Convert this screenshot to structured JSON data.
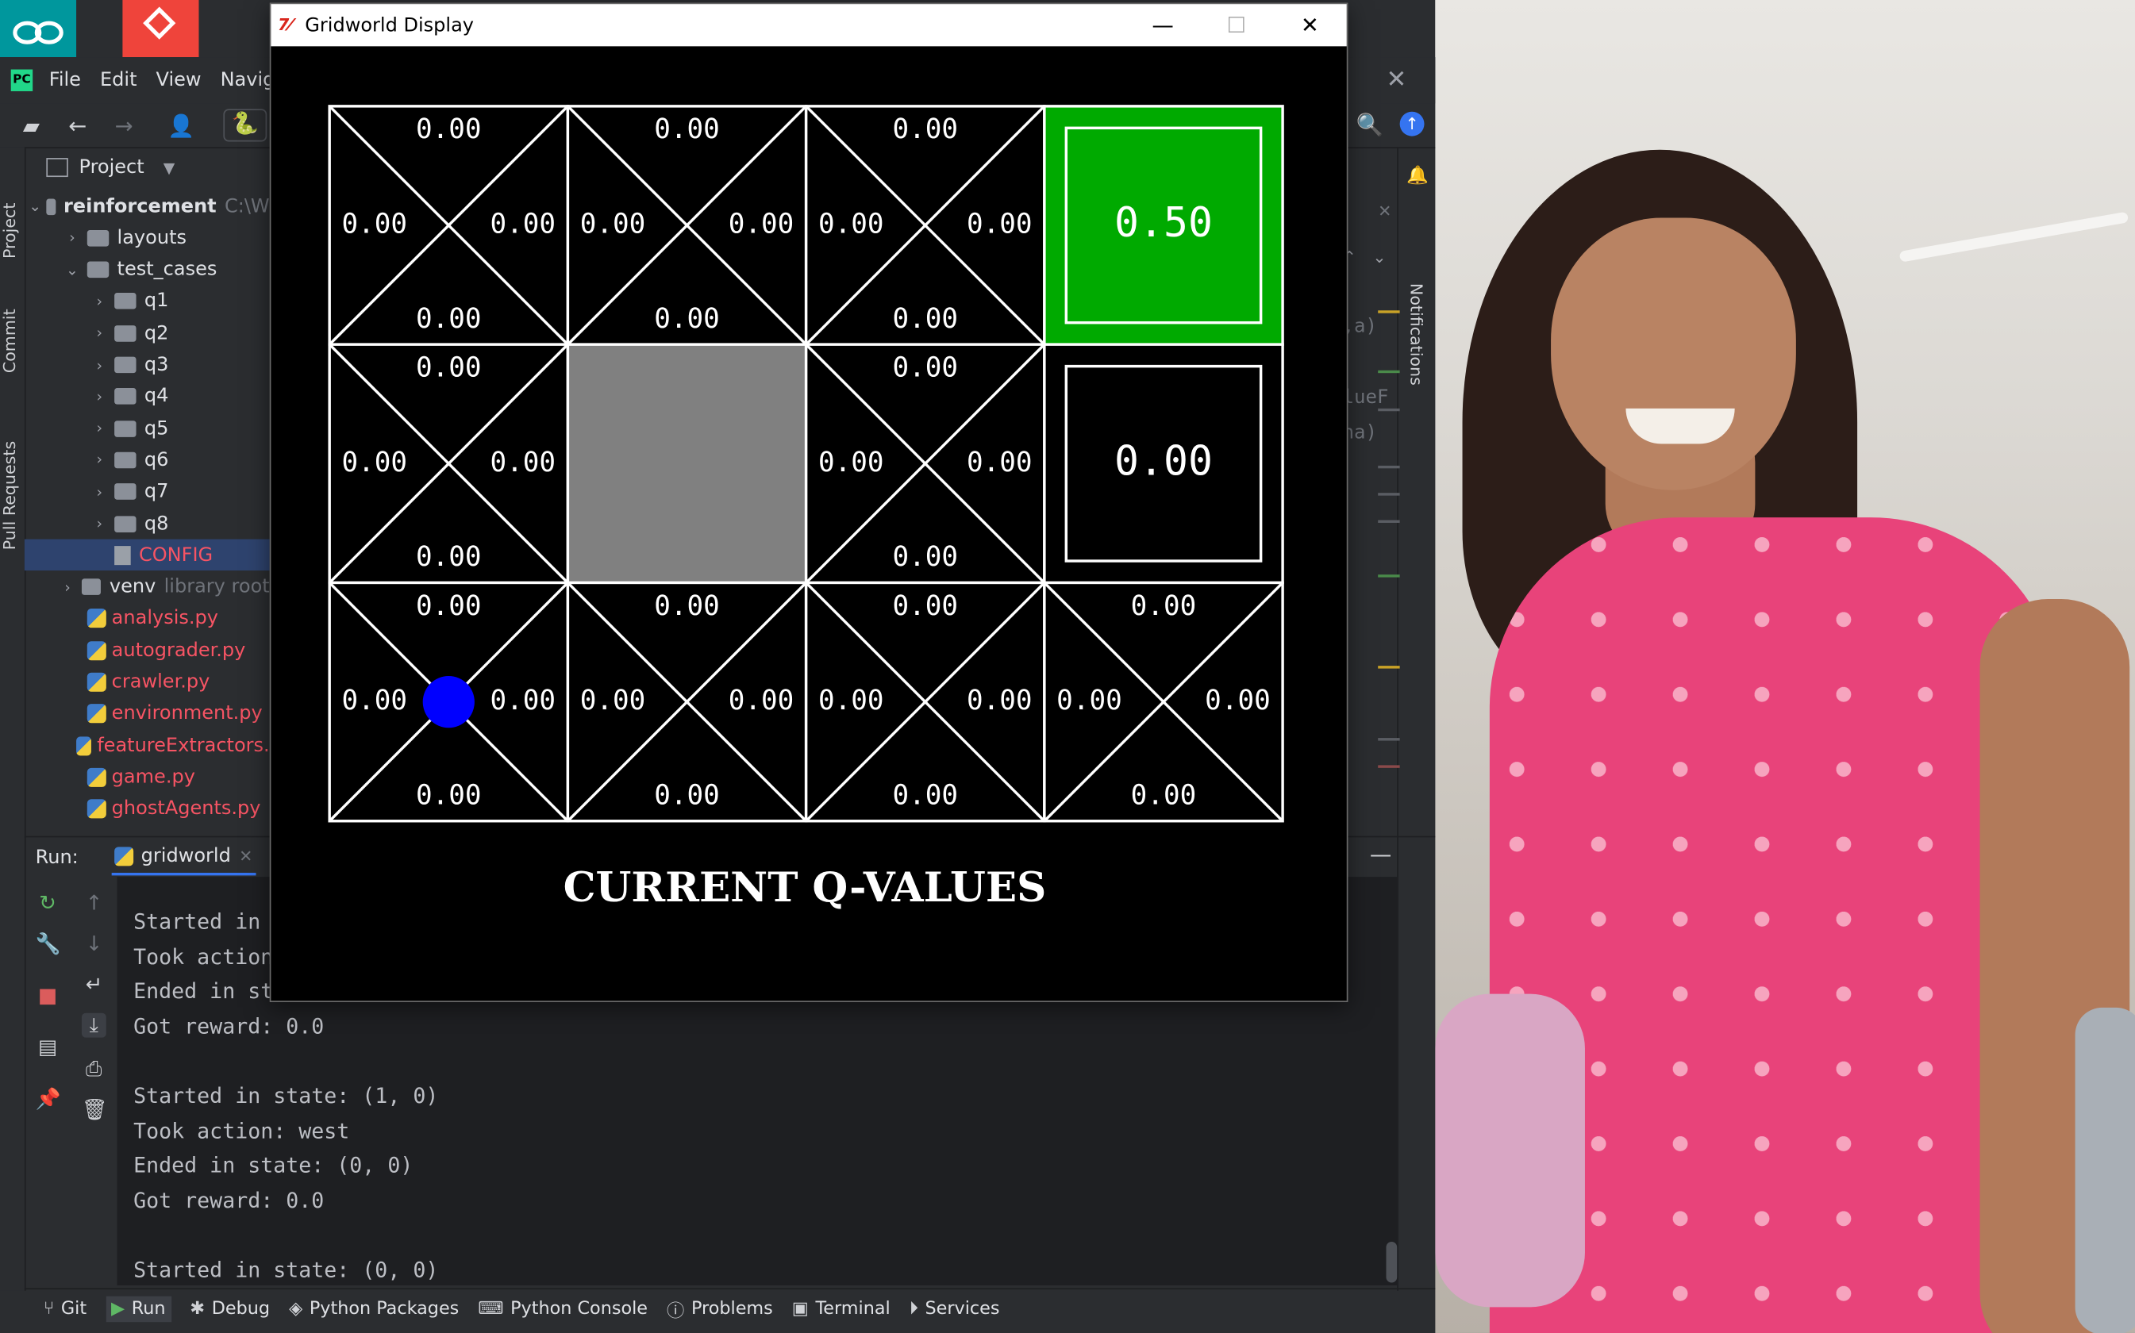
{
  "ide": {
    "menu": [
      "File",
      "Edit",
      "View",
      "Navig"
    ],
    "project_label": "Project",
    "tree": [
      {
        "label": "reinforcement",
        "suffix": "C:\\W",
        "kind": "folder",
        "expanded": true,
        "depth": 0
      },
      {
        "label": "layouts",
        "kind": "folder",
        "expanded": false,
        "depth": 1
      },
      {
        "label": "test_cases",
        "kind": "folder",
        "expanded": true,
        "depth": 1
      },
      {
        "label": "q1",
        "kind": "folder",
        "expanded": false,
        "depth": 2
      },
      {
        "label": "q2",
        "kind": "folder",
        "expanded": false,
        "depth": 2
      },
      {
        "label": "q3",
        "kind": "folder",
        "expanded": false,
        "depth": 2
      },
      {
        "label": "q4",
        "kind": "folder",
        "expanded": false,
        "depth": 2
      },
      {
        "label": "q5",
        "kind": "folder",
        "expanded": false,
        "depth": 2
      },
      {
        "label": "q6",
        "kind": "folder",
        "expanded": false,
        "depth": 2
      },
      {
        "label": "q7",
        "kind": "folder",
        "expanded": false,
        "depth": 2
      },
      {
        "label": "q8",
        "kind": "folder",
        "expanded": false,
        "depth": 2
      },
      {
        "label": "CONFIG",
        "kind": "file",
        "depth": 2,
        "selected": true
      },
      {
        "label": "venv",
        "suffix": "library root",
        "kind": "folder",
        "expanded": false,
        "depth": 1
      },
      {
        "label": "analysis.py",
        "kind": "py",
        "depth": 1
      },
      {
        "label": "autograder.py",
        "kind": "py",
        "depth": 1
      },
      {
        "label": "crawler.py",
        "kind": "py",
        "depth": 1
      },
      {
        "label": "environment.py",
        "kind": "py",
        "depth": 1
      },
      {
        "label": "featureExtractors.",
        "kind": "py",
        "depth": 1
      },
      {
        "label": "game.py",
        "kind": "py",
        "depth": 1
      },
      {
        "label": "ghostAgents.py",
        "kind": "py",
        "depth": 1
      }
    ],
    "vertical_tabs": [
      "Project",
      "Commit",
      "Pull Requests"
    ],
    "right_tab": "Notifications",
    "code_fragments": [
      ",a)",
      "lueF",
      "ha)"
    ],
    "run_label": "Run:",
    "run_tab": "gridworld",
    "console_lines": [
      "Started in",
      "Took action",
      "Ended in st",
      "Got reward: 0.0",
      "",
      "Started in state: (1, 0)",
      "Took action: west",
      "Ended in state: (0, 0)",
      "Got reward: 0.0",
      "",
      "Started in state: (0, 0)"
    ],
    "bottom_tabs": [
      {
        "label": "Git",
        "icon": "git-icon"
      },
      {
        "label": "Run",
        "icon": "run-icon"
      },
      {
        "label": "Debug",
        "icon": "debug-icon"
      },
      {
        "label": "Python Packages",
        "icon": "packages-icon"
      },
      {
        "label": "Python Console",
        "icon": "python-console-icon"
      },
      {
        "label": "Problems",
        "icon": "problems-icon"
      },
      {
        "label": "Terminal",
        "icon": "terminal-icon"
      },
      {
        "label": "Services",
        "icon": "services-icon"
      }
    ]
  },
  "gridworld": {
    "window_title": "Gridworld Display",
    "caption": "CURRENT Q-VALUES",
    "colors": {
      "terminal_positive": "#00aa00",
      "wall": "#808080",
      "agent": "#0000ff",
      "line": "#ffffff"
    },
    "grid": [
      [
        {
          "type": "q",
          "n": "0.00",
          "s": "0.00",
          "w": "0.00",
          "e": "0.00"
        },
        {
          "type": "wall"
        },
        {
          "type": "q",
          "n": "0.00",
          "s": "0.00",
          "w": "0.00",
          "e": "0.00"
        },
        {
          "type": "terminal",
          "value": "0.00"
        }
      ],
      [
        {
          "type": "q",
          "n": "0.00",
          "s": "0.00",
          "w": "0.00",
          "e": "0.00"
        },
        {
          "type": "wall"
        },
        {
          "type": "q",
          "n": "0.00",
          "s": "0.00",
          "w": "0.00",
          "e": "0.00"
        },
        {
          "type": "terminal",
          "value": "0.00"
        }
      ]
    ],
    "rows": [
      [
        {
          "type": "q",
          "n": "0.00",
          "s": "0.00",
          "w": "0.00",
          "e": "0.00"
        },
        {
          "type": "q",
          "n": "0.00",
          "s": "0.00",
          "w": "0.00",
          "e": "0.00"
        },
        {
          "type": "q",
          "n": "0.00",
          "s": "0.00",
          "w": "0.00",
          "e": "0.00"
        },
        {
          "type": "terminal",
          "value": "0.50",
          "positive": true
        }
      ],
      [
        {
          "type": "q",
          "n": "0.00",
          "s": "0.00",
          "w": "0.00",
          "e": "0.00"
        },
        {
          "type": "wall"
        },
        {
          "type": "q",
          "n": "0.00",
          "s": "0.00",
          "w": "0.00",
          "e": "0.00"
        },
        {
          "type": "terminal",
          "value": "0.00",
          "positive": false
        }
      ],
      [
        {
          "type": "q",
          "n": "0.00",
          "s": "0.00",
          "w": "0.00",
          "e": "0.00",
          "agent": true
        },
        {
          "type": "q",
          "n": "0.00",
          "s": "0.00",
          "w": "0.00",
          "e": "0.00"
        },
        {
          "type": "q",
          "n": "0.00",
          "s": "0.00",
          "w": "0.00",
          "e": "0.00"
        },
        {
          "type": "q",
          "n": "0.00",
          "s": "0.00",
          "w": "0.00",
          "e": "0.00"
        }
      ]
    ]
  }
}
